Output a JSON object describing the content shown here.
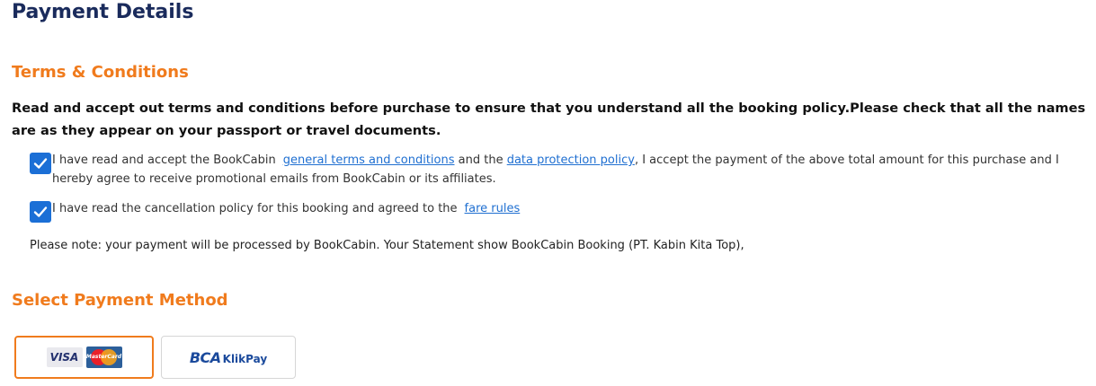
{
  "header": {
    "title": "Payment Details"
  },
  "terms": {
    "title": "Terms & Conditions",
    "intro": "Read and accept out terms and conditions before purchase to ensure that you understand all the booking policy.Please check that all the names are as they appear on your passport or travel documents.",
    "checkbox_terms": {
      "checked": true,
      "text_before": "I have read and accept the BookCabin",
      "link_terms": "general terms and conditions",
      "text_mid": "and the",
      "link_privacy": " data protection policy",
      "text_after": ", I accept the payment of the above total amount for this purchase and I hereby agree to receive promotional emails from BookCabin or its affiliates."
    },
    "checkbox_fare": {
      "checked": true,
      "text_before": "I have read the cancellation policy for this booking and agreed to the",
      "link_fare": "fare rules"
    },
    "note": "Please note: your payment will be processed by BookCabin. Your Statement show BookCabin Booking (PT. Kabin Kita Top),"
  },
  "payment": {
    "title": "Select Payment Method",
    "methods": [
      {
        "visa_text": "VISA",
        "mastercard_text": "MasterCard",
        "selected": true,
        "accent": "#f07b1d"
      },
      {
        "bca_text": "BCA",
        "klikpay_text": "KlikPay",
        "selected": false
      }
    ]
  },
  "colors": {
    "heading": "#1a2b5c",
    "accent": "#f07b1d",
    "link": "#1f6fd1",
    "checkbox": "#1b6fd6"
  }
}
